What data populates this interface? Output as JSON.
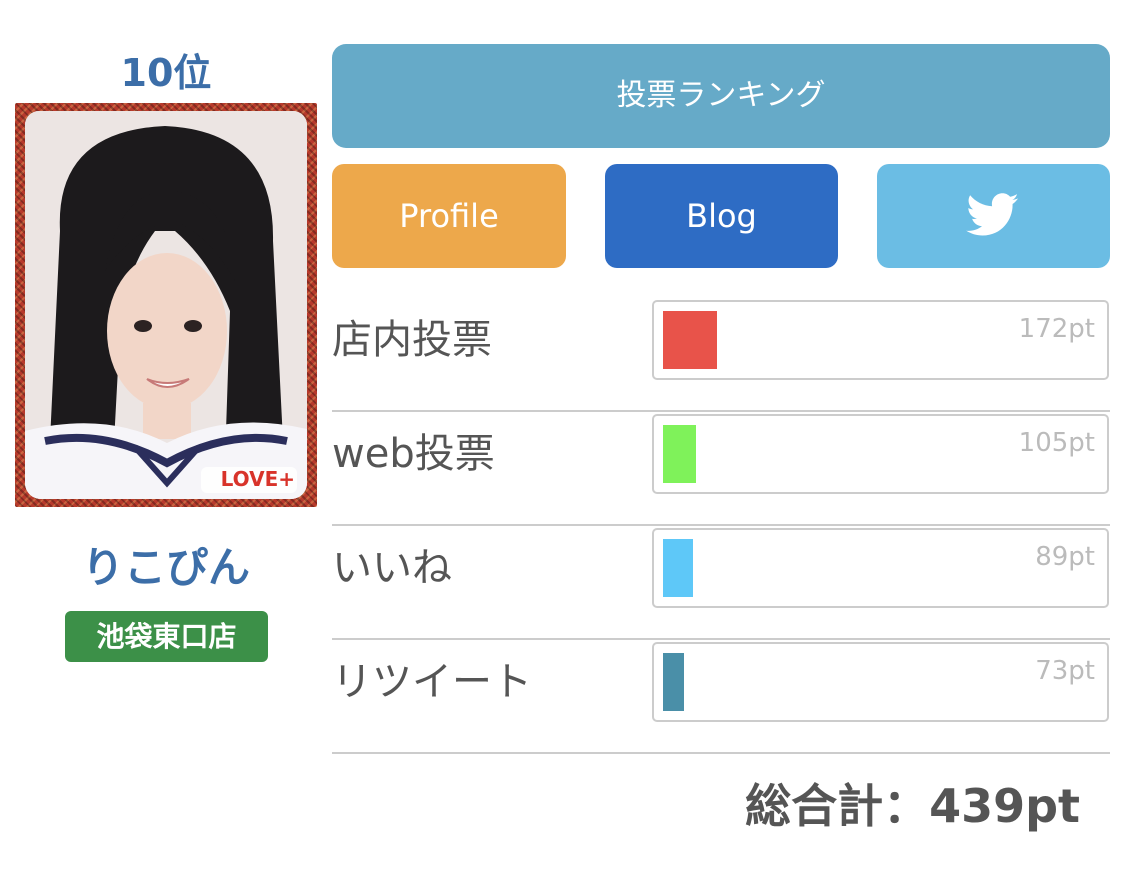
{
  "member": {
    "rank": "10位",
    "name": "りこぴん",
    "store": "池袋東口店",
    "photo_watermark": "LOVE+"
  },
  "buttons": {
    "ranking": "投票ランキング",
    "profile": "Profile",
    "blog": "Blog",
    "twitter_icon": "twitter-bird"
  },
  "votes": [
    {
      "label": "店内投票",
      "value": "172pt",
      "fill_ratio": 0.125,
      "color": "#e8534a"
    },
    {
      "label": "web投票",
      "value": "105pt",
      "fill_ratio": 0.076,
      "color": "#7ff25a"
    },
    {
      "label": "いいね",
      "value": "89pt",
      "fill_ratio": 0.068,
      "color": "#5ec8f8"
    },
    {
      "label": "リツイート",
      "value": "73pt",
      "fill_ratio": 0.048,
      "color": "#4a8fa8"
    }
  ],
  "total": "総合計：439pt"
}
